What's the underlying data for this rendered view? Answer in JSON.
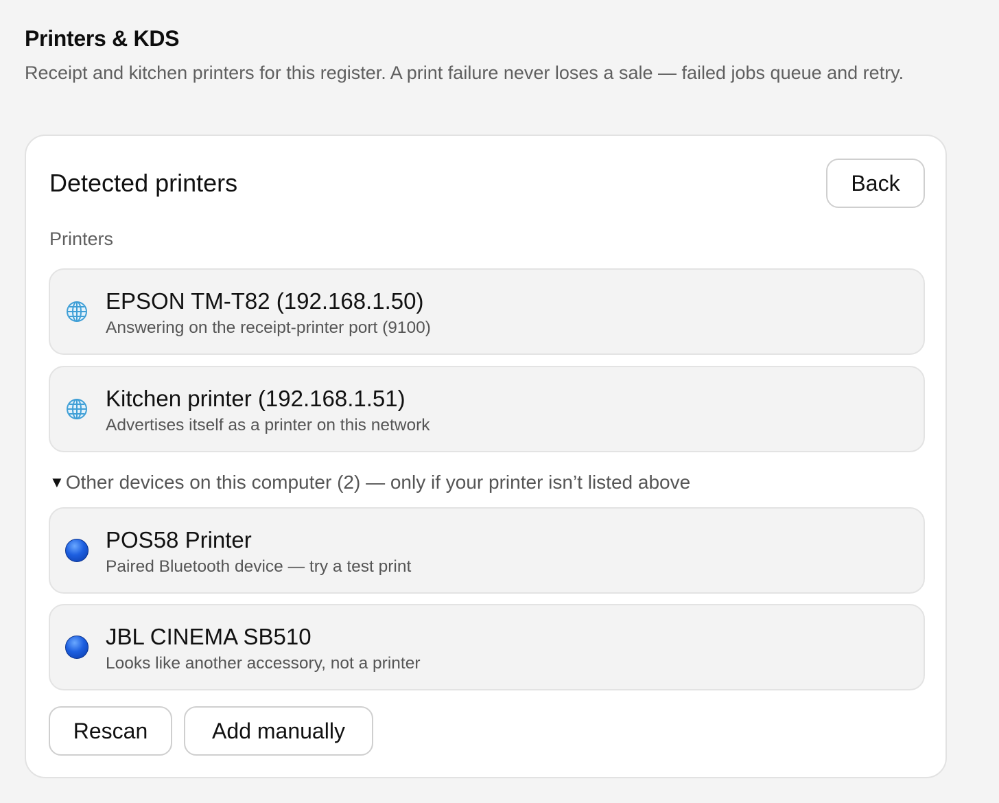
{
  "header": {
    "title": "Printers & KDS",
    "subtitle": "Receipt and kitchen printers for this register. A print failure never loses a sale — failed jobs queue and retry."
  },
  "card": {
    "title": "Detected printers",
    "back_label": "Back",
    "section_label": "Printers",
    "printers": [
      {
        "name": "EPSON TM-T82 (192.168.1.50)",
        "desc": "Answering on the receipt-printer port (9100)",
        "icon": "globe-icon"
      },
      {
        "name": "Kitchen printer (192.168.1.51)",
        "desc": "Advertises itself as a printer on this network",
        "icon": "globe-icon"
      }
    ],
    "other_devices": {
      "toggle_glyph": "▼",
      "label": "Other devices on this computer (2) — only if your printer isn’t listed above",
      "items": [
        {
          "name": "POS58 Printer",
          "desc": "Paired Bluetooth device — try a test print",
          "icon": "blue-circle-icon"
        },
        {
          "name": "JBL CINEMA SB510",
          "desc": "Looks like another accessory, not a printer",
          "icon": "blue-circle-icon"
        }
      ]
    },
    "rescan_label": "Rescan",
    "add_manually_label": "Add manually"
  },
  "colors": {
    "background": "#f4f4f4",
    "card": "#ffffff",
    "row": "#f3f3f3",
    "globe": "#3f9fd6",
    "bluetooth_dot": "#1d5fe0"
  }
}
